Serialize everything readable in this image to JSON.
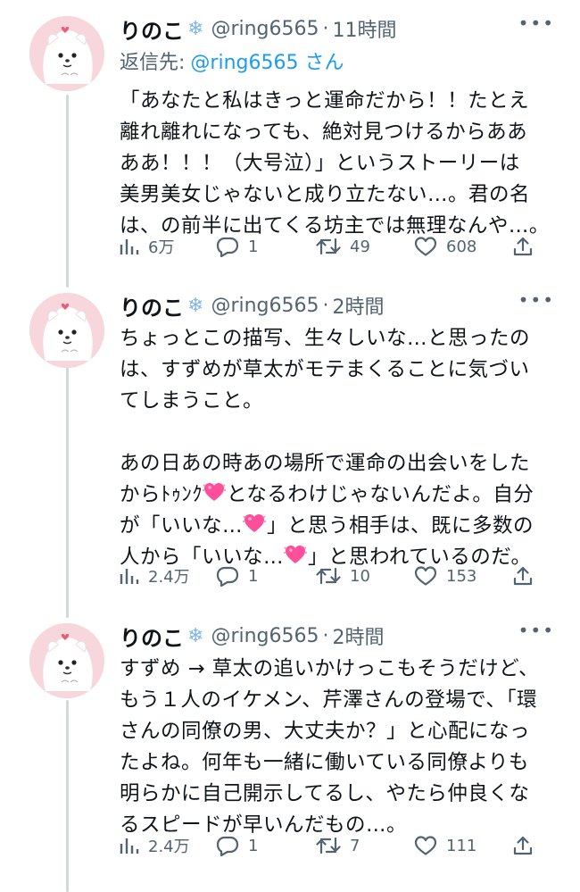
{
  "tweets": [
    {
      "name": "りのこ",
      "badge": "❄",
      "handle": "@ring6565",
      "sep": "·",
      "time": "11時間",
      "reply_prefix": "返信先:",
      "reply_mention": "@ring6565 さん",
      "lines": [
        "「あなたと私はきっと運命だから！！たとえ",
        "離れ離れになっても、絶対見つけるからああ",
        "ああ！！！（大号泣）」というストーリーは",
        "美男美女じゃないと成り立たない…。君の名",
        "は、の前半に出てくる坊主では無理なんや…。"
      ],
      "views": "6万",
      "replies": "1",
      "retweets": "49",
      "likes": "608"
    },
    {
      "name": "りのこ",
      "badge": "❄",
      "handle": "@ring6565",
      "sep": "·",
      "time": "2時間",
      "lines": [
        "ちょっとこの描写、生々しいな…と思ったの",
        "は、すずめが草太がモテまくることに気づい",
        "てしまうこと。",
        "",
        "あの日あの時あの場所で運命の出会いをした"
      ],
      "line6_a": "からﾄｩﾝｸ",
      "line6_b": "となるわけじゃないんだよ。自分",
      "line7_a": "が「いいな…",
      "line7_b": "」と思う相手は、既に多数の",
      "line8_a": "人から「いいな…",
      "line8_b": "」と思われているのだ。",
      "views": "2.4万",
      "replies": "1",
      "retweets": "10",
      "likes": "153"
    },
    {
      "name": "りのこ",
      "badge": "❄",
      "handle": "@ring6565",
      "sep": "·",
      "time": "2時間",
      "lines": [
        "すずめ → 草太の追いかけっこもそうだけど、",
        "もう１人のイケメン、芹澤さんの登場で、「環",
        "さんの同僚の男、大丈夫か？」と心配になっ",
        "たよね。何年も一緒に働いている同僚よりも",
        "明らかに自己開示してるし、やたら仲良くな",
        "るスピードが早いんだもの…。"
      ],
      "views": "2.4万",
      "replies": "1",
      "retweets": "7",
      "likes": "111"
    }
  ],
  "icons": [
    "views-icon",
    "reply-icon",
    "retweet-icon",
    "like-icon",
    "share-icon",
    "more-icon",
    "heart-emoji-icon",
    "snowflake-icon"
  ]
}
